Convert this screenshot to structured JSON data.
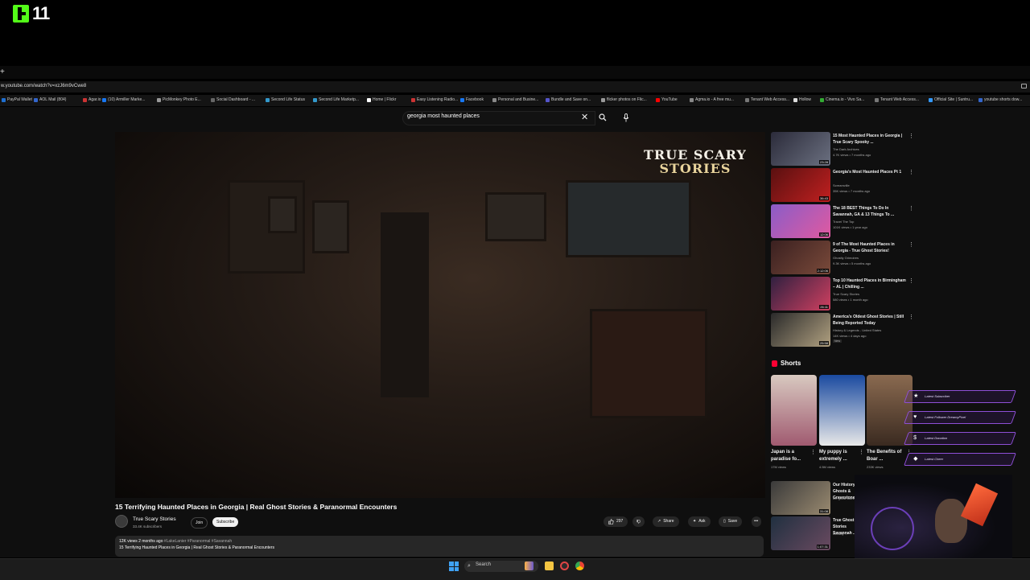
{
  "stream": {
    "logo_text": "11"
  },
  "browser": {
    "new_tab": "+",
    "url": "w.youtube.com/watch?v=xzJ6m9vCwe8",
    "bookmarks": [
      {
        "label": "PayPal Wallet",
        "color": "#1f6fd1"
      },
      {
        "label": "AOL Mail (804)",
        "color": "#3366cc"
      },
      {
        "label": "Agar.io",
        "color": "#cc3333"
      },
      {
        "label": "(10) Armiller Marke...",
        "color": "#1877f2"
      },
      {
        "label": "PicMonkey Photo E...",
        "color": "#999999"
      },
      {
        "label": "Social Dashboard - ...",
        "color": "#666666"
      },
      {
        "label": "Second Life Status",
        "color": "#3399cc"
      },
      {
        "label": "Second Life Marketp...",
        "color": "#3399cc"
      },
      {
        "label": "Home | Flickr",
        "color": "#ffffff"
      },
      {
        "label": "Easy Listening Radio...",
        "color": "#cc3333"
      },
      {
        "label": "Facebook",
        "color": "#1877f2"
      },
      {
        "label": "Personal and Busine...",
        "color": "#888888"
      },
      {
        "label": "Bundle and Save on...",
        "color": "#5555cc"
      },
      {
        "label": "flicker photos on Flic...",
        "color": "#999999"
      },
      {
        "label": "YouTube",
        "color": "#ff0000"
      },
      {
        "label": "Agma.io - A free mu...",
        "color": "#888888"
      },
      {
        "label": "Tenant Web Access...",
        "color": "#777777"
      },
      {
        "label": "Hollow",
        "color": "#dddddd"
      },
      {
        "label": "Cinema.io - Vivo Sa...",
        "color": "#33aa33"
      },
      {
        "label": "Tenant Web Access...",
        "color": "#777777"
      },
      {
        "label": "Official Site | Suntru...",
        "color": "#3399ff"
      },
      {
        "label": "youtube shorts dow...",
        "color": "#3366cc"
      }
    ]
  },
  "search": {
    "query": "georgia most haunted places"
  },
  "video": {
    "brand_line1": "TRUE SCARY",
    "brand_line2": "STORIES",
    "title": "15 Terrifying Haunted Places in Georgia | Real Ghost Stories & Paranormal Encounters",
    "channel": "True Scary Stories",
    "subscribers": "33.4K subscribers",
    "join_label": "Join",
    "subscribe_label": "Subscribe",
    "likes": "297",
    "share_label": "Share",
    "ask_label": "Ask",
    "save_label": "Save",
    "desc_views": "12K views  2 months ago",
    "desc_tags": "#LakeLanier #Paranormal #Savannah",
    "desc_text": "15 Terrifying Haunted Places in Georgia | Real Ghost Stories & Paranormal Encounters"
  },
  "recommendations": [
    {
      "title": "15 Most Haunted Places in Georgia | True Scary Spooky ...",
      "channel": "The Dark Archives",
      "views": "4.7K views • 7 months ago",
      "duration": "23:28",
      "badge": ""
    },
    {
      "title": "Georgia's Most Haunted Places Pt 1",
      "channel": "Screamville",
      "views": "35K views • 7 months ago",
      "duration": "36:43",
      "badge": ""
    },
    {
      "title": "The 18 BEST Things To Do In Savannah, GA & 13 Things To ...",
      "channel": "Travel The Top",
      "views": "101K views • 1 year ago",
      "duration": "12:06",
      "badge": ""
    },
    {
      "title": "9 of The Most Haunted Places in Georgia - True Ghost Stories!",
      "channel": "Ghostly Grimoires",
      "views": "9.3K views • 5 months ago",
      "duration": "2:12:06",
      "badge": ""
    },
    {
      "title": "Top 10 Haunted Places in Birmingham – AL | Chilling ...",
      "channel": "True Scary Stories",
      "views": "580 views • 1 month ago",
      "duration": "26:11",
      "badge": ""
    },
    {
      "title": "America's Oldest Ghost Stories | Still Being Reported Today",
      "channel": "History & Legends - United States",
      "views": "14K views • 4 days ago",
      "duration": "25:58",
      "badge": "New"
    }
  ],
  "shorts": {
    "heading": "Shorts",
    "items": [
      {
        "title": "Japan is a paradise fo...",
        "views": "17M views"
      },
      {
        "title": "My puppy is extremely ...",
        "views": "4.5M views"
      },
      {
        "title": "The Benefits of Boar ...",
        "views": "233K views"
      }
    ]
  },
  "more_recs": [
    {
      "title": "Our History, Ghosts & Gravestones",
      "channel": "the ghost tours",
      "duration": "31:08"
    },
    {
      "title": "True Ghost Stories Savannah ...",
      "channel": "Ghostly ...",
      "duration": "1:07:31"
    }
  ],
  "alerts": [
    {
      "label": "Latest Subscriber",
      "icon": "★"
    },
    {
      "label": "Latest Follower  DreamyPixel",
      "icon": "♥"
    },
    {
      "label": "Latest Donation",
      "icon": "$"
    },
    {
      "label": "Latest Cheer",
      "icon": "◆"
    }
  ],
  "taskbar": {
    "search_label": "Search"
  }
}
